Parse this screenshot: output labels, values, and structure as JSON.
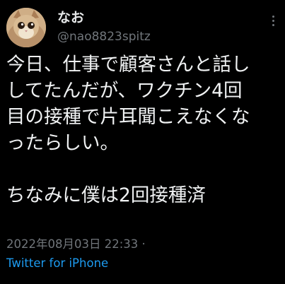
{
  "user": {
    "display_name": "なお",
    "handle": "@nao8823spitz"
  },
  "tweet": {
    "lines": [
      "今日、仕事で顧客さんと話し",
      "してたんだが、ワクチン4回",
      "目の接種で片耳聞こえなくな",
      "ったらしい。",
      "",
      "ちなみに僕は2回接種済"
    ],
    "timestamp": "2022年08月03日 22:33",
    "separator": "·",
    "source": "Twitter for iPhone"
  },
  "icons": {
    "more": "more-vertical-icon",
    "avatar": "cat-avatar"
  },
  "colors": {
    "background": "#000000",
    "text": "#e7e9ea",
    "secondary": "#71767b",
    "link": "#1d9bf0"
  }
}
